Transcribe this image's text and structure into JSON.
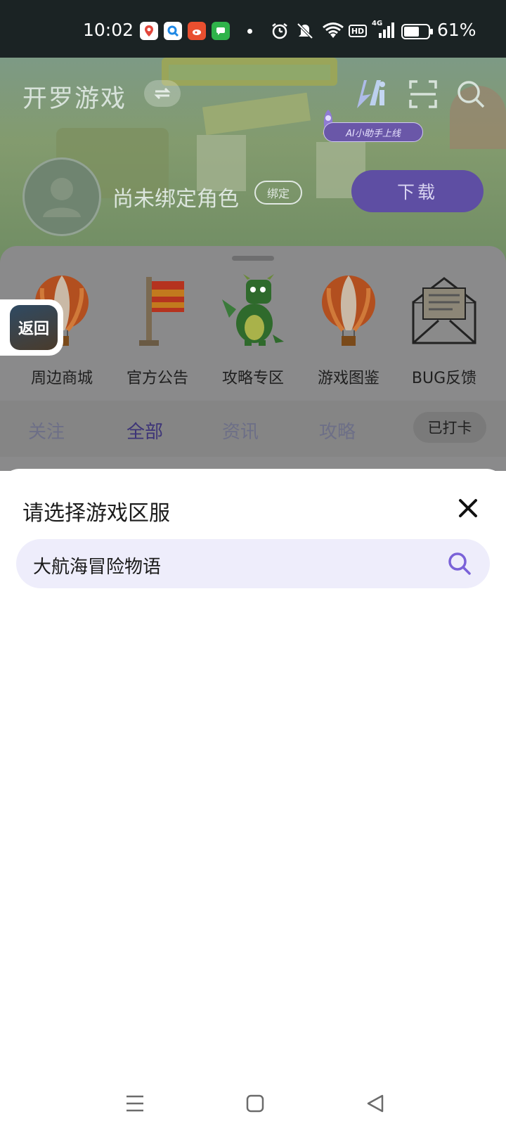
{
  "status_bar": {
    "time": "10:02",
    "battery_percent": "61%",
    "network": "4G",
    "hd_label": "HD",
    "app_icons": [
      "maps-icon",
      "search-app-icon",
      "weibo-icon",
      "messages-icon"
    ]
  },
  "header": {
    "app_title": "开罗游戏",
    "ai_badge": "AI小助手上线",
    "role_name": "尚未绑定角色",
    "bind_label": "绑定",
    "download_label": "下载"
  },
  "shortcuts": [
    {
      "label": "周边商城",
      "icon": "hot-air-balloon-icon"
    },
    {
      "label": "官方公告",
      "icon": "flag-icon"
    },
    {
      "label": "攻略专区",
      "icon": "dragon-icon"
    },
    {
      "label": "游戏图鉴",
      "icon": "hot-air-balloon-icon"
    },
    {
      "label": "BUG反馈",
      "icon": "envelope-icon"
    }
  ],
  "tabs": {
    "items": [
      "关注",
      "全部",
      "资讯",
      "攻略"
    ],
    "active_index": 1,
    "checkin_label": "已打卡"
  },
  "back_float": {
    "label": "返回"
  },
  "sheet": {
    "title": "请选择游戏区服",
    "search_value": "大航海冒险物语"
  },
  "colors": {
    "accent": "#7a62d8",
    "search_bg": "#eeedfb",
    "download_bg": "#5e4ea3"
  }
}
